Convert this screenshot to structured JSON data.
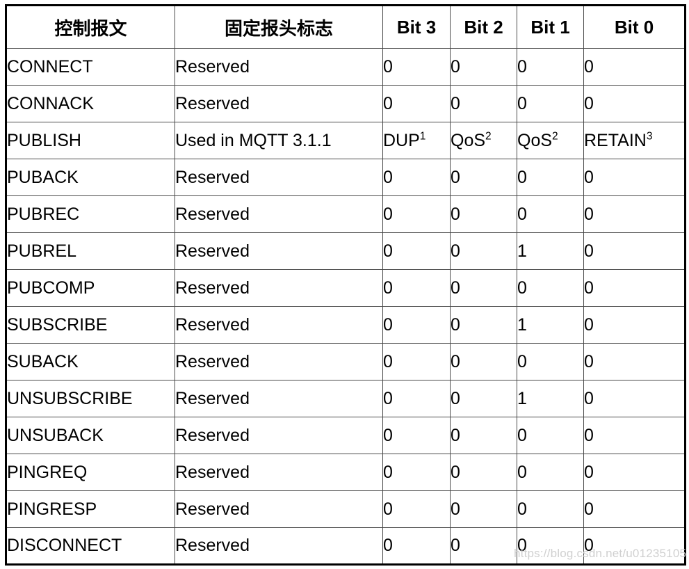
{
  "table": {
    "headers": [
      "控制报文",
      "固定报头标志",
      "Bit 3",
      "Bit 2",
      "Bit 1",
      "Bit 0"
    ],
    "rows": [
      {
        "message": "CONNECT",
        "flags": "Reserved",
        "bit3": "0",
        "bit3_sup": "",
        "bit2": "0",
        "bit2_sup": "",
        "bit1": "0",
        "bit1_sup": "",
        "bit0": "0",
        "bit0_sup": ""
      },
      {
        "message": "CONNACK",
        "flags": "Reserved",
        "bit3": "0",
        "bit3_sup": "",
        "bit2": "0",
        "bit2_sup": "",
        "bit1": "0",
        "bit1_sup": "",
        "bit0": "0",
        "bit0_sup": ""
      },
      {
        "message": "PUBLISH",
        "flags": "Used in MQTT 3.1.1",
        "bit3": "DUP",
        "bit3_sup": "1",
        "bit2": "QoS",
        "bit2_sup": "2",
        "bit1": "QoS",
        "bit1_sup": "2",
        "bit0": "RETAIN",
        "bit0_sup": "3"
      },
      {
        "message": "PUBACK",
        "flags": "Reserved",
        "bit3": "0",
        "bit3_sup": "",
        "bit2": "0",
        "bit2_sup": "",
        "bit1": "0",
        "bit1_sup": "",
        "bit0": "0",
        "bit0_sup": ""
      },
      {
        "message": "PUBREC",
        "flags": "Reserved",
        "bit3": "0",
        "bit3_sup": "",
        "bit2": "0",
        "bit2_sup": "",
        "bit1": "0",
        "bit1_sup": "",
        "bit0": "0",
        "bit0_sup": ""
      },
      {
        "message": "PUBREL",
        "flags": "Reserved",
        "bit3": "0",
        "bit3_sup": "",
        "bit2": "0",
        "bit2_sup": "",
        "bit1": "1",
        "bit1_sup": "",
        "bit0": "0",
        "bit0_sup": ""
      },
      {
        "message": "PUBCOMP",
        "flags": "Reserved",
        "bit3": "0",
        "bit3_sup": "",
        "bit2": "0",
        "bit2_sup": "",
        "bit1": "0",
        "bit1_sup": "",
        "bit0": "0",
        "bit0_sup": ""
      },
      {
        "message": "SUBSCRIBE",
        "flags": "Reserved",
        "bit3": "0",
        "bit3_sup": "",
        "bit2": "0",
        "bit2_sup": "",
        "bit1": "1",
        "bit1_sup": "",
        "bit0": "0",
        "bit0_sup": ""
      },
      {
        "message": "SUBACK",
        "flags": "Reserved",
        "bit3": "0",
        "bit3_sup": "",
        "bit2": "0",
        "bit2_sup": "",
        "bit1": "0",
        "bit1_sup": "",
        "bit0": "0",
        "bit0_sup": ""
      },
      {
        "message": "UNSUBSCRIBE",
        "flags": "Reserved",
        "bit3": "0",
        "bit3_sup": "",
        "bit2": "0",
        "bit2_sup": "",
        "bit1": "1",
        "bit1_sup": "",
        "bit0": "0",
        "bit0_sup": ""
      },
      {
        "message": "UNSUBACK",
        "flags": "Reserved",
        "bit3": "0",
        "bit3_sup": "",
        "bit2": "0",
        "bit2_sup": "",
        "bit1": "0",
        "bit1_sup": "",
        "bit0": "0",
        "bit0_sup": ""
      },
      {
        "message": "PINGREQ",
        "flags": "Reserved",
        "bit3": "0",
        "bit3_sup": "",
        "bit2": "0",
        "bit2_sup": "",
        "bit1": "0",
        "bit1_sup": "",
        "bit0": "0",
        "bit0_sup": ""
      },
      {
        "message": "PINGRESP",
        "flags": "Reserved",
        "bit3": "0",
        "bit3_sup": "",
        "bit2": "0",
        "bit2_sup": "",
        "bit1": "0",
        "bit1_sup": "",
        "bit0": "0",
        "bit0_sup": ""
      },
      {
        "message": "DISCONNECT",
        "flags": "Reserved",
        "bit3": "0",
        "bit3_sup": "",
        "bit2": "0",
        "bit2_sup": "",
        "bit1": "0",
        "bit1_sup": "",
        "bit0": "0",
        "bit0_sup": ""
      }
    ]
  },
  "watermark": {
    "text": "https://blog.csdn.net/u01235105"
  },
  "colors": {
    "page_background": "#ffffff",
    "text": "#000000",
    "grid_line": "#4a4a4a",
    "outer_border": "#000000",
    "watermark": "#d0d0d0"
  }
}
